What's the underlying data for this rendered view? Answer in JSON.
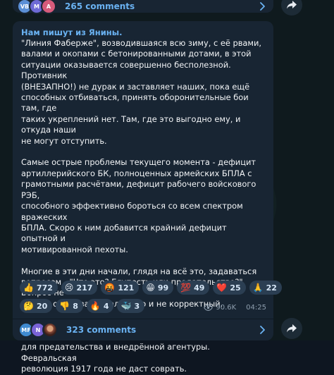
{
  "top_thread": {
    "avatars": [
      {
        "initials": "VB",
        "color": "#5b8fd6"
      },
      {
        "initials": "M",
        "color": "#6e6ad6"
      },
      {
        "initials": "A",
        "color": "#d65b7b"
      }
    ],
    "comments_label": "265 comments"
  },
  "post": {
    "author": "Нам пишут из Янины.",
    "text": "\"Линия Фаберже\", возводившаяся всю зиму, с её рвами,\nвалами и окопами с бетонированными дотами, в этой\nситуации оказывается совершенно бесполезной. Противник\n(ВНЕЗАПНО!) не дурак и заставляет наших, пока ещё\nспособных отбиваться, принять оборонительные бои там, где\nтаких укреплений нет. Там, где это выгодно ему, и откуда наши\nне могут отступить.\n\nСамые острые проблемы текущего момента - дефицит\nартиллерийского БК, полноценных армейских БПЛА с\nграмотными расчётами, дефицит рабочего войскового РЭБ,\nспособного эффективно бороться со всем спектром вражеских\nБПЛА. Скоро к ним добавится крайний дефицит опытной и\nмотивированной пехоты.\n\nМногие в эти дни начали, глядя на всё это, задаваться\nвопросом - \"Что это? Глупость или предательство?\" Вопрос не\nтолько очень запоздалый, но и не корректный.\n\nГлупость и некомпетентность - прекрасная первичная почва\nдля предательства и внедрённой агентуры. Февральская\nреволюция 1917 года не даст соврать.",
    "reactions_row1": [
      {
        "emoji": "👍",
        "count": "772"
      },
      {
        "emoji": "😢",
        "count": "217"
      },
      {
        "emoji": "🤬",
        "count": "121"
      },
      {
        "emoji": "😁",
        "count": "99"
      },
      {
        "emoji": "💯",
        "count": "49"
      },
      {
        "emoji": "❤️",
        "count": "25"
      },
      {
        "emoji": "🙏",
        "count": "22"
      }
    ],
    "reactions_row2": [
      {
        "emoji": "🤔",
        "count": "20"
      },
      {
        "emoji": "👎",
        "count": "8"
      },
      {
        "emoji": "🔥",
        "count": "4"
      },
      {
        "emoji": "🐳",
        "count": "3"
      }
    ],
    "views": "90.6K",
    "time": "04:25"
  },
  "bottom_thread": {
    "avatars": [
      {
        "initials": "MF",
        "color": "#3f8ad0"
      },
      {
        "initials": "N",
        "color": "#7a63d6"
      },
      {
        "initials": "",
        "color": "#8a4b3a"
      }
    ],
    "comments_label": "323 comments"
  },
  "icons": {
    "share": "share-arrow-icon",
    "chevron": "chevron-right-icon",
    "views": "eye-icon"
  },
  "colors": {
    "accent": "#6ab2f2",
    "bubble": "#182533",
    "reaction_pill": "#2b3e52"
  }
}
